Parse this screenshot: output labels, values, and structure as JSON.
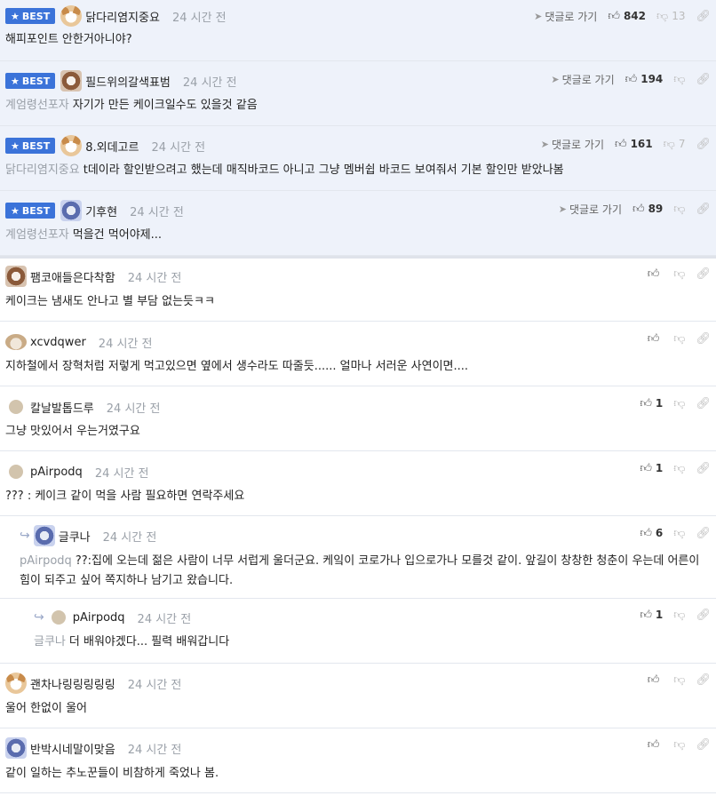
{
  "best_label": "BEST",
  "time_label": "24 시간 전",
  "goto_label": "댓글로 가기",
  "best": [
    {
      "nick": "닭다리염지중요",
      "avatar": "dog",
      "ref": "",
      "text": "해피포인트 안한거아니야?",
      "up": "842",
      "down": "13"
    },
    {
      "nick": "필드위의갈색표범",
      "avatar": "shaggy",
      "ref": "계엄령선포자",
      "text": "자기가 만든 케이크일수도 있을것 같음",
      "up": "194",
      "down": ""
    },
    {
      "nick": "8.외데고르",
      "avatar": "dog",
      "ref": "닭다리염지중요",
      "text": "t데이라 할인받으려고 했는데 매직바코드 아니고 그냥 멤버쉽 바코드 보여줘서 기본 할인만 받았나봄",
      "up": "161",
      "down": "7"
    },
    {
      "nick": "기후현",
      "avatar": "mask",
      "ref": "계엄령선포자",
      "text": "먹을건 먹어야제...",
      "up": "89",
      "down": ""
    }
  ],
  "comments": [
    {
      "nick": "팸코애들은다착함",
      "avatar": "shaggy",
      "ref": "",
      "text": "케이크는 냄새도 안나고 별 부담 없는듯ㅋㅋ",
      "up": "",
      "indent": 0
    },
    {
      "nick": "xcvdqwer",
      "avatar": "dot-wide",
      "ref": "",
      "text": "지하철에서 장혁처럼 저렇게 먹고있으면 옆에서 생수라도 따줄듯...... 얼마나 서러운 사연이면....",
      "up": "",
      "indent": 0
    },
    {
      "nick": "칼날발톱드루",
      "avatar": "dot",
      "ref": "",
      "text": "그냥 맛있어서 우는거였구요",
      "up": "1",
      "indent": 0
    },
    {
      "nick": "pAirpodq",
      "avatar": "dot",
      "ref": "",
      "text": "??? : 케이크 같이 먹을 사람 필요하면 연락주세요",
      "up": "1",
      "indent": 0
    },
    {
      "nick": "글쿠나",
      "avatar": "mask",
      "ref": "pAirpodq",
      "text": "??:집에 오는데 젊은 사람이 너무 서럽게 울더군요. 케잌이 코로가나 입으로가나 모를것 같이. 앞길이 창창한 청춘이 우는데 어른이 힘이 되주고 싶어 쪽지하나 남기고 왔습니다.",
      "up": "6",
      "indent": 1
    },
    {
      "nick": "pAirpodq",
      "avatar": "dot",
      "ref": "글쿠나",
      "text": "더 배워야겠다... 필력 배워갑니다",
      "up": "1",
      "indent": 2
    },
    {
      "nick": "괜차나링링링링링",
      "avatar": "dog",
      "ref": "",
      "text": "울어 한없이 울어",
      "up": "",
      "indent": 0
    },
    {
      "nick": "반박시네말이맞음",
      "avatar": "mask",
      "ref": "",
      "text": "같이 일하는 추노꾼들이 비참하게 죽었나 봄.",
      "up": "",
      "indent": 0
    }
  ]
}
